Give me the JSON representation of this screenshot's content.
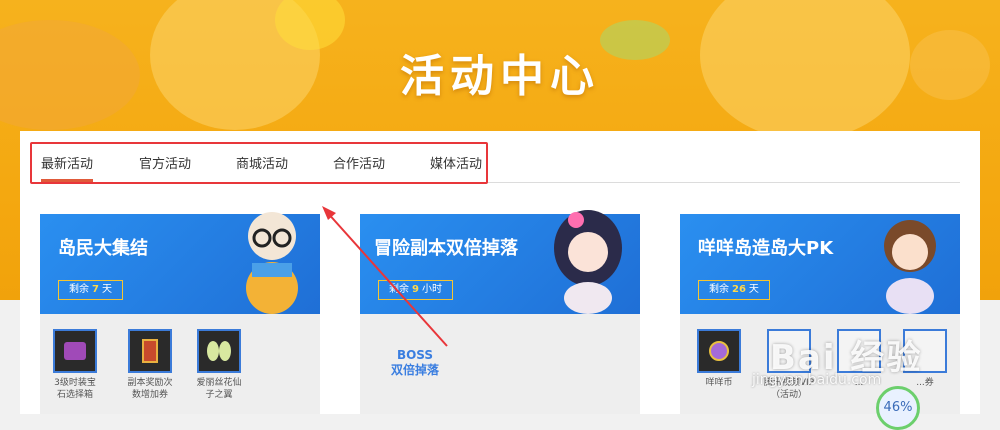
{
  "hero": {
    "title": "活动中心"
  },
  "tabs": [
    {
      "label": "最新活动",
      "active": true
    },
    {
      "label": "官方活动"
    },
    {
      "label": "商城活动"
    },
    {
      "label": "合作活动"
    },
    {
      "label": "媒体活动"
    }
  ],
  "cards": [
    {
      "title": "岛民大集结",
      "remain_prefix": "剩余",
      "remain_value": "7",
      "remain_unit": "天",
      "items": [
        {
          "label": "3级时装宝石选择箱",
          "line1": "3级时装宝",
          "line2": "石选择箱"
        },
        {
          "label": "副本奖励次数增加券",
          "line1": "副本奖励次",
          "line2": "数增加券"
        },
        {
          "label": "爱丽丝花仙子之翼",
          "line1": "爱丽丝花仙",
          "line2": "子之翼"
        }
      ]
    },
    {
      "title": "冒险副本双倍掉落",
      "remain_prefix": "剩余",
      "remain_value": "9",
      "remain_unit": "小时",
      "boss_line1": "BOSS",
      "boss_line2": "双倍掉落"
    },
    {
      "title": "咩咩岛造岛大PK",
      "remain_prefix": "剩余",
      "remain_value": "26",
      "remain_unit": "天",
      "items": [
        {
          "label": "咩咩币"
        },
        {
          "label": "腾讯视频VIP（活动）",
          "line1": "腾讯视频VIP",
          "line2": "（活动）"
        },
        {
          "label": "..."
        },
        {
          "label": "...券"
        }
      ]
    }
  ],
  "watermark": {
    "brand": "Bai 经验",
    "url": "jingyan.baidu.com"
  },
  "progress": {
    "value": "46%"
  },
  "colors": {
    "hero_bg": "#f4a70f",
    "banner_bg": "#1f6fd6",
    "highlight": "#e8363a",
    "tab_underline": "#e05a3a"
  }
}
